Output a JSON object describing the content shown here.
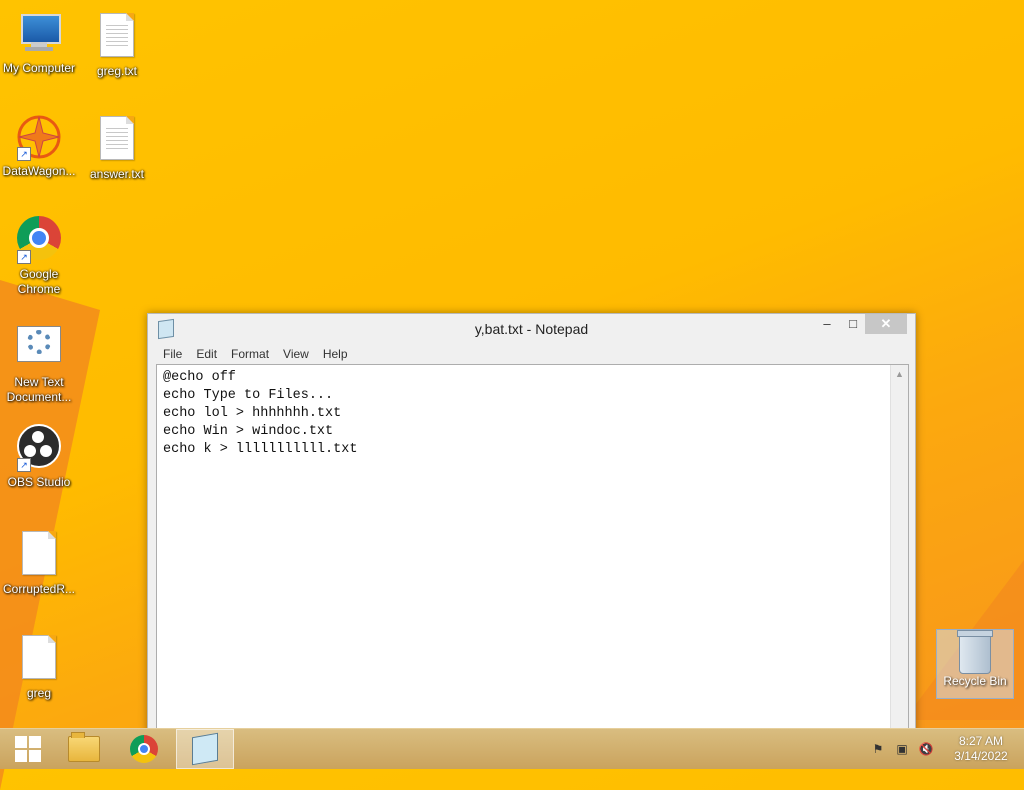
{
  "desktop": {
    "icons": [
      {
        "label": "My Computer"
      },
      {
        "label": "greg.txt"
      },
      {
        "label": "DataWagon..."
      },
      {
        "label": "answer.txt"
      },
      {
        "label": "Google Chrome"
      },
      {
        "label": "New Text Document..."
      },
      {
        "label": "OBS Studio"
      },
      {
        "label": "CorruptedR..."
      },
      {
        "label": "greg"
      }
    ],
    "recycle_bin": {
      "label": "Recycle Bin"
    }
  },
  "notepad": {
    "title": "y,bat.txt - Notepad",
    "menu": [
      "File",
      "Edit",
      "Format",
      "View",
      "Help"
    ],
    "content": "@echo off\necho Type to Files...\necho lol > hhhhhhh.txt\necho Win > windoc.txt\necho k > lllllllllll.txt",
    "buttons": {
      "minimize": "–",
      "maximize": "□",
      "close": "✕"
    }
  },
  "taskbar": {
    "clock_time": "8:27 AM",
    "clock_date": "3/14/2022",
    "tray_icons": [
      "action-center-flag-icon",
      "network-icon",
      "volume-muted-icon"
    ]
  }
}
